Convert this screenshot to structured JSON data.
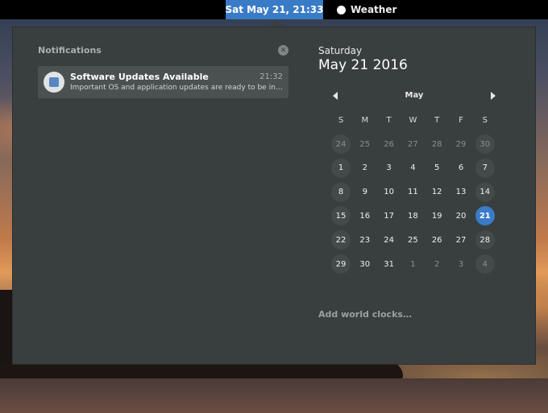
{
  "topbar": {
    "clock": "Sat May 21, 21:33",
    "weather_label": "Weather"
  },
  "notifications": {
    "title": "Notifications",
    "clear_label": "✕",
    "items": [
      {
        "title": "Software Updates Available",
        "time": "21:32",
        "body": "Important OS and application updates are ready to be installed"
      }
    ]
  },
  "calendar": {
    "weekday": "Saturday",
    "date": "May 21 2016",
    "month": "May",
    "day_headers": [
      "S",
      "M",
      "T",
      "W",
      "T",
      "F",
      "S"
    ],
    "weeks": [
      [
        "24",
        "25",
        "26",
        "27",
        "28",
        "29",
        "30"
      ],
      [
        "1",
        "2",
        "3",
        "4",
        "5",
        "6",
        "7"
      ],
      [
        "8",
        "9",
        "10",
        "11",
        "12",
        "13",
        "14"
      ],
      [
        "15",
        "16",
        "17",
        "18",
        "19",
        "20",
        "21"
      ],
      [
        "22",
        "23",
        "24",
        "25",
        "26",
        "27",
        "28"
      ],
      [
        "29",
        "30",
        "31",
        "1",
        "2",
        "3",
        "4"
      ]
    ],
    "today": "21"
  },
  "world_clocks": {
    "label": "Add world clocks…"
  },
  "colors": {
    "accent": "#3a7bc8",
    "panel": "#393f3f"
  }
}
